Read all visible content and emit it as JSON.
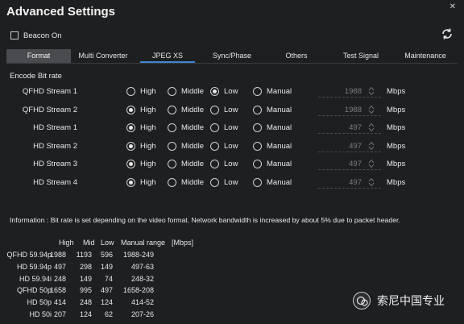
{
  "window": {
    "title": "Advanced Settings"
  },
  "beacon": {
    "label": "Beacon On",
    "checked": false
  },
  "tabs": [
    {
      "label": "Format"
    },
    {
      "label": "Multi Converter"
    },
    {
      "label": "JPEG XS"
    },
    {
      "label": "Sync/Phase"
    },
    {
      "label": "Others"
    },
    {
      "label": "Test Signal"
    },
    {
      "label": "Maintenance"
    }
  ],
  "encode": {
    "section_label": "Encode Bit rate",
    "options": [
      "High",
      "Middle",
      "Low",
      "Manual"
    ],
    "unit": "Mbps",
    "streams": [
      {
        "name": "QFHD Stream 1",
        "selected": "Low",
        "value": "1988"
      },
      {
        "name": "QFHD Stream 2",
        "selected": "High",
        "value": "1988"
      },
      {
        "name": "HD Stream 1",
        "selected": "High",
        "value": "497"
      },
      {
        "name": "HD Stream 2",
        "selected": "High",
        "value": "497"
      },
      {
        "name": "HD Stream 3",
        "selected": "High",
        "value": "497"
      },
      {
        "name": "HD Stream 4",
        "selected": "High",
        "value": "497"
      }
    ]
  },
  "info": {
    "text": "Information : Bit rate is set depending on the video format. Network bandwidth is increased by about 5% due to packet header."
  },
  "table": {
    "headers": [
      "High",
      "Mid",
      "Low",
      "Manual range",
      "[Mbps]"
    ],
    "rows": [
      [
        "QFHD 59.94p",
        "1988",
        "1193",
        "596",
        "1988-249"
      ],
      [
        "HD 59.94p",
        "497",
        "298",
        "149",
        "497-63"
      ],
      [
        "HD 59.94i",
        "248",
        "149",
        "74",
        "248-32"
      ],
      [
        "QFHD 50p",
        "1658",
        "995",
        "497",
        "1658-208"
      ],
      [
        "HD 50p",
        "414",
        "248",
        "124",
        "414-52"
      ],
      [
        "HD 50i",
        "207",
        "124",
        "62",
        "207-26"
      ]
    ]
  },
  "watermark": {
    "text": "索尼中国专业"
  }
}
